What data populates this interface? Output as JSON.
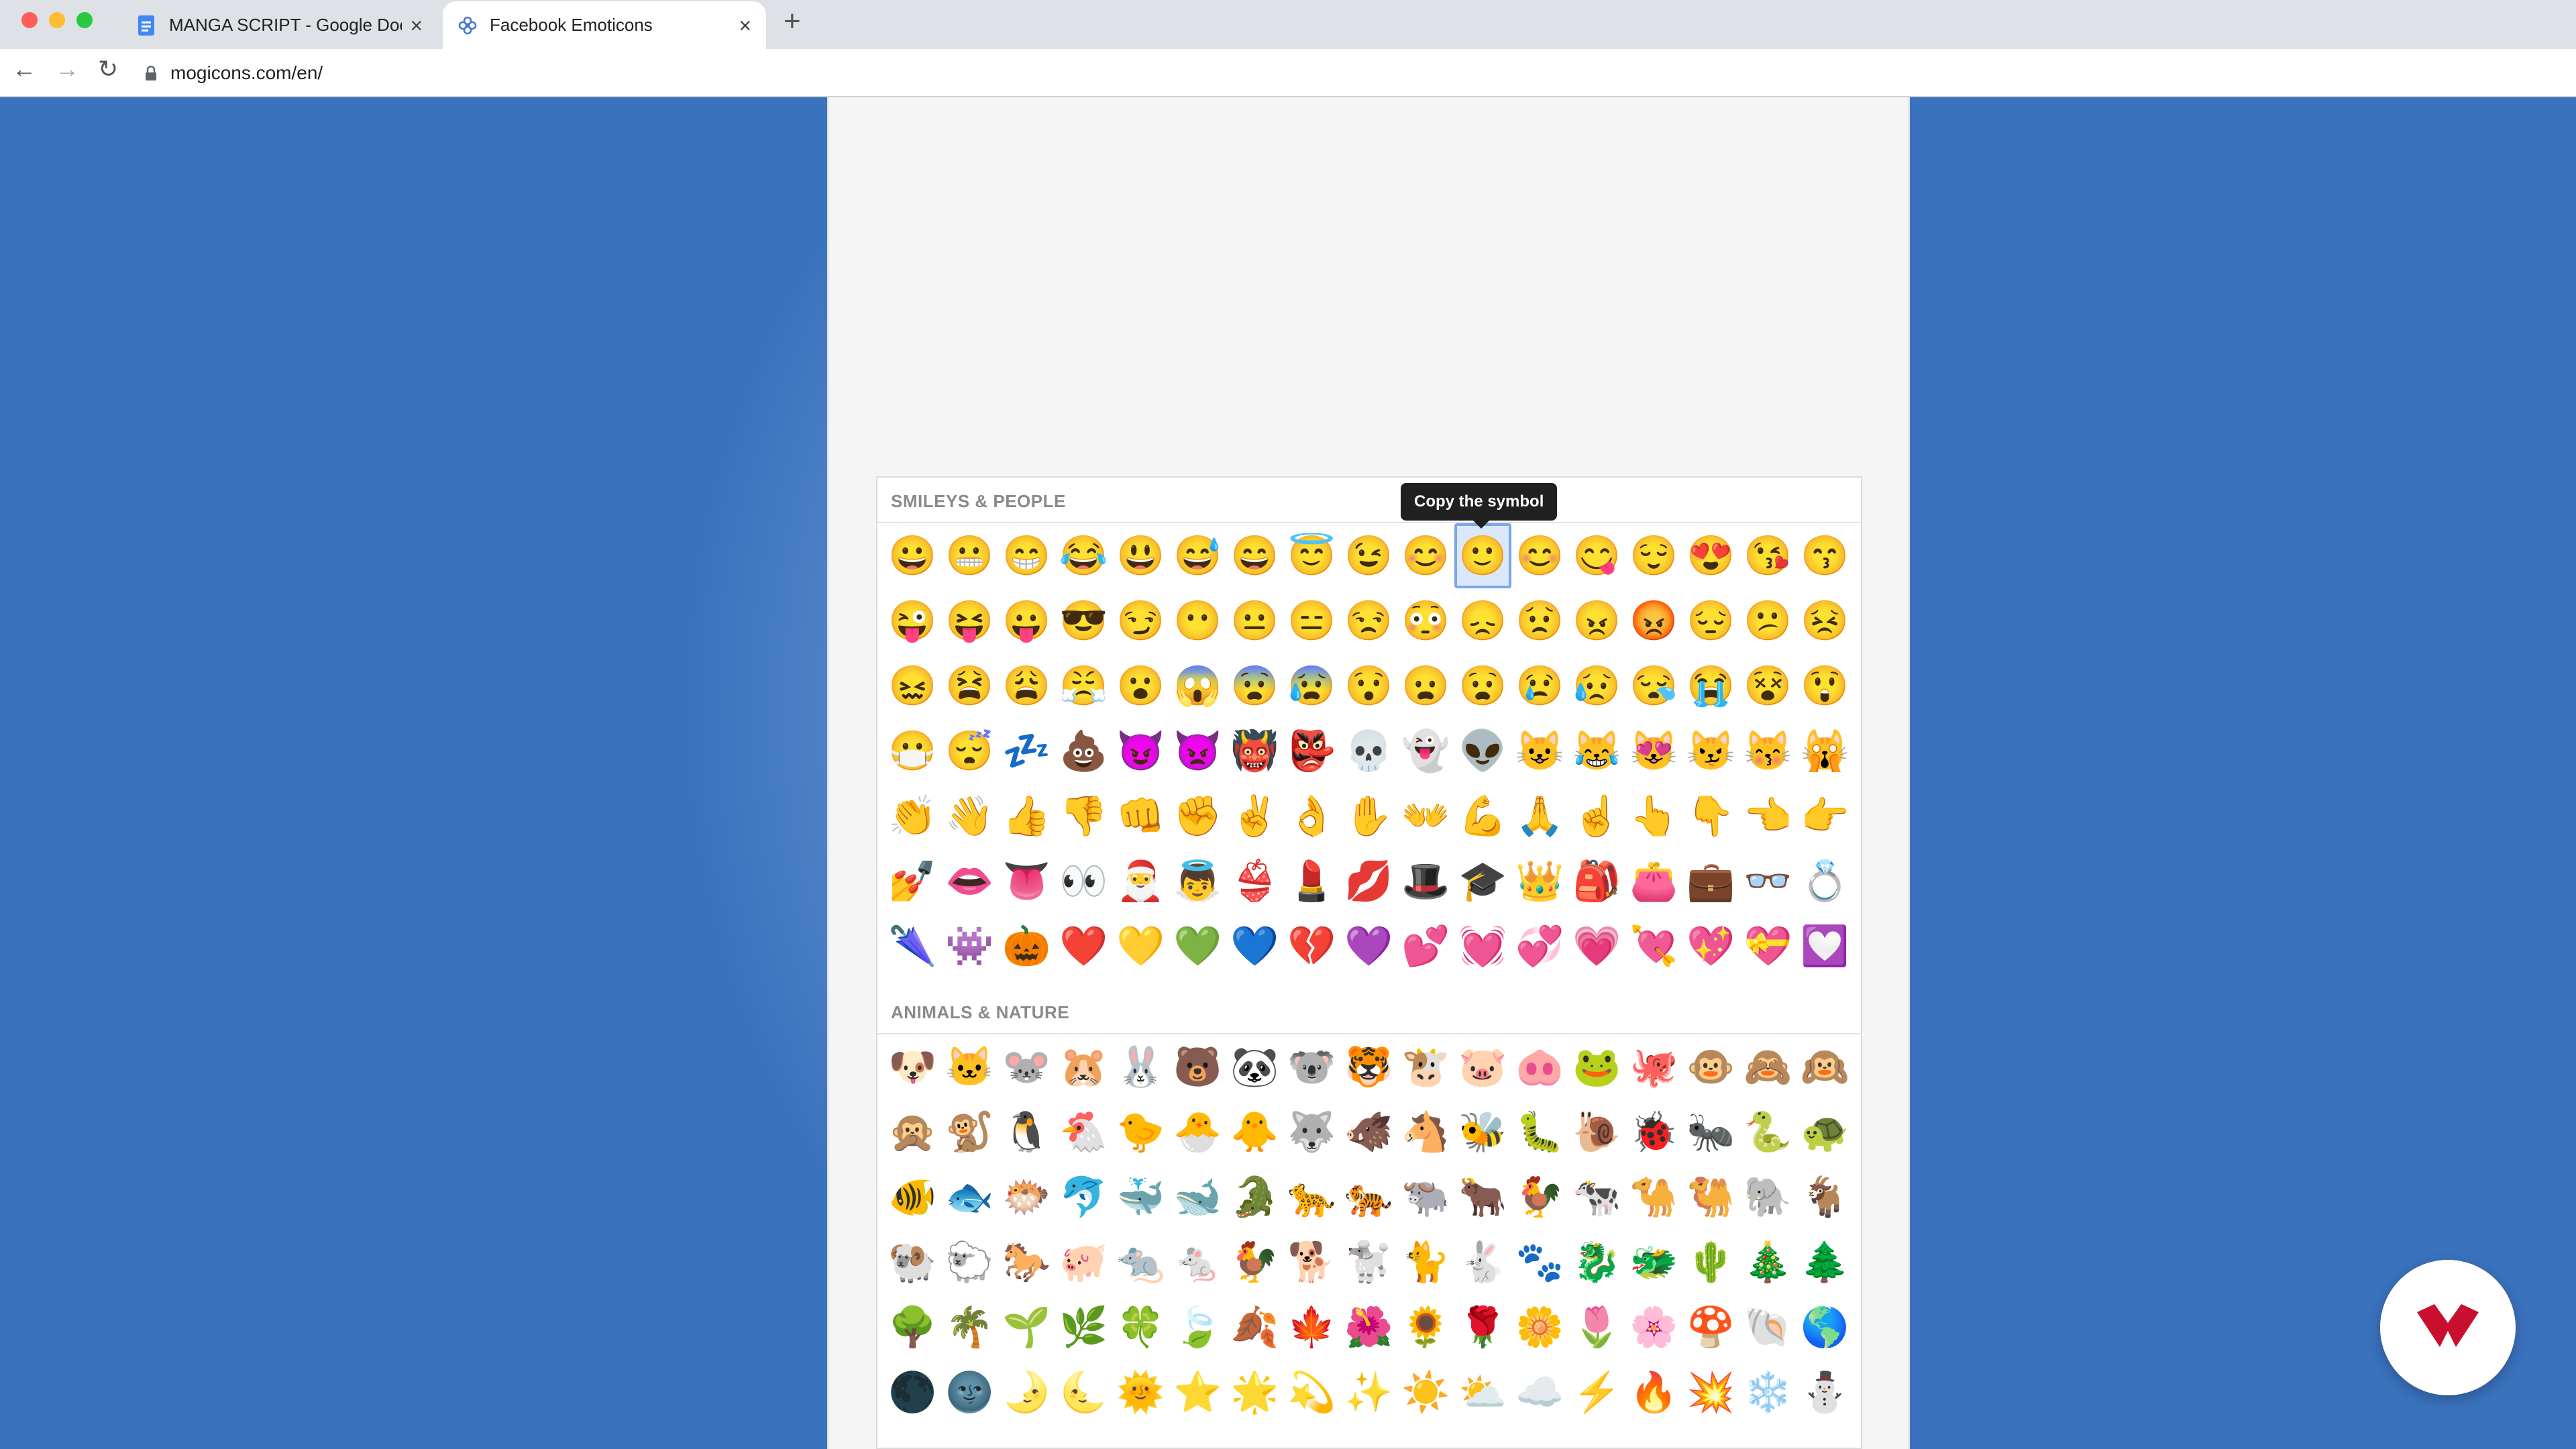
{
  "browser": {
    "tabs": [
      {
        "title": "MANGA SCRIPT - Google Docs",
        "icon": "google-docs-icon",
        "active": false
      },
      {
        "title": "Facebook Emoticons",
        "icon": "flower-icon",
        "active": true
      }
    ],
    "url": "mogicons.com/en/",
    "colors": {
      "tabbar": "#dee1e6",
      "close": "#ff5f57",
      "minimize": "#febc2e",
      "maximize": "#28c840"
    }
  },
  "tooltip": {
    "text": "Copy the symbol"
  },
  "sections": [
    {
      "title": "SMILEYS & PEOPLE",
      "emojis": [
        "😀",
        "😬",
        "😁",
        "😂",
        "😃",
        "😅",
        "😄",
        "😇",
        "😉",
        "😊",
        "🙂",
        "😊",
        "😋",
        "😌",
        "😍",
        "😘",
        "😙",
        "😜",
        "😝",
        "😛",
        "😎",
        "😏",
        "😶",
        "😐",
        "😑",
        "😒",
        "😳",
        "😞",
        "😟",
        "😠",
        "😡",
        "😔",
        "😕",
        "😣",
        "😖",
        "😫",
        "😩",
        "😤",
        "😮",
        "😱",
        "😨",
        "😰",
        "😯",
        "😦",
        "😧",
        "😢",
        "😥",
        "😪",
        "😭",
        "😵",
        "😲",
        "😷",
        "😴",
        "💤",
        "💩",
        "😈",
        "👿",
        "👹",
        "👺",
        "💀",
        "👻",
        "👽",
        "😺",
        "😹",
        "😻",
        "😼",
        "😽",
        "🙀",
        "👏",
        "👋",
        "👍",
        "👎",
        "👊",
        "✊",
        "✌️",
        "👌",
        "✋",
        "👐",
        "💪",
        "🙏",
        "☝️",
        "👆",
        "👇",
        "👈",
        "👉",
        "💅",
        "👄",
        "👅",
        "👀",
        "🎅",
        "👼",
        "👙",
        "💄",
        "💋",
        "🎩",
        "🎓",
        "👑",
        "🎒",
        "👛",
        "💼",
        "👓",
        "💍",
        "🌂",
        "👾",
        "🎃",
        "❤️",
        "💛",
        "💚",
        "💙",
        "💔",
        "💜",
        "💕",
        "💓",
        "💞",
        "💗",
        "💘",
        "💖",
        "💝",
        "💟"
      ],
      "selected_index": 10
    },
    {
      "title": "ANIMALS & NATURE",
      "emojis": [
        "🐶",
        "🐱",
        "🐭",
        "🐹",
        "🐰",
        "🐻",
        "🐼",
        "🐨",
        "🐯",
        "🐮",
        "🐷",
        "🐽",
        "🐸",
        "🐙",
        "🐵",
        "🙈",
        "🙉",
        "🙊",
        "🐒",
        "🐧",
        "🐔",
        "🐤",
        "🐣",
        "🐥",
        "🐺",
        "🐗",
        "🐴",
        "🐝",
        "🐛",
        "🐌",
        "🐞",
        "🐜",
        "🐍",
        "🐢",
        "🐠",
        "🐟",
        "🐡",
        "🐬",
        "🐳",
        "🐋",
        "🐊",
        "🐆",
        "🐅",
        "🐃",
        "🐂",
        "🐓",
        "🐄",
        "🐪",
        "🐫",
        "🐘",
        "🐐",
        "🐏",
        "🐑",
        "🐎",
        "🐖",
        "🐀",
        "🐁",
        "🐓",
        "🐕",
        "🐩",
        "🐈",
        "🐇",
        "🐾",
        "🐉",
        "🐲",
        "🌵",
        "🎄",
        "🌲",
        "🌳",
        "🌴",
        "🌱",
        "🌿",
        "🍀",
        "🍃",
        "🍂",
        "🍁",
        "🌺",
        "🌻",
        "🌹",
        "🌼",
        "🌷",
        "🌸",
        "🍄",
        "🐚",
        "🌎",
        "🌑",
        "🌚",
        "🌛",
        "🌜",
        "🌞",
        "⭐",
        "🌟",
        "💫",
        "✨",
        "☀️",
        "⛅",
        "☁️",
        "⚡",
        "🔥",
        "💥",
        "❄️",
        "⛄"
      ]
    }
  ]
}
